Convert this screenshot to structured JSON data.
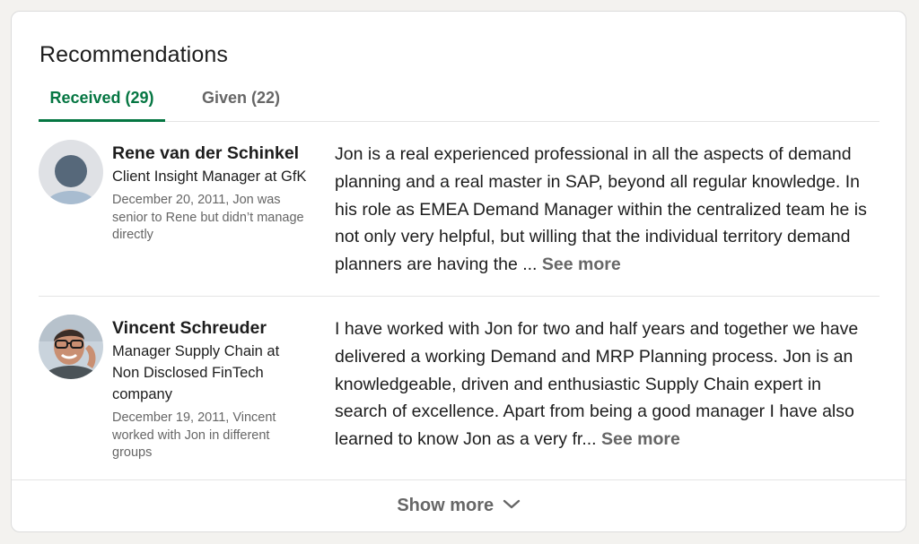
{
  "section": {
    "title": "Recommendations"
  },
  "tabs": [
    {
      "label": "Received (29)",
      "active": true
    },
    {
      "label": "Given (22)",
      "active": false
    }
  ],
  "recommendations": [
    {
      "name": "Rene van der Schinkel",
      "headline": "Client Insight Manager at GfK",
      "meta": "December 20, 2011, Jon was senior to Rene but didn’t manage directly",
      "text": "Jon is a real experienced professional in all the aspects of demand planning and a real master in SAP, beyond all regular knowledge. In his role as EMEA Demand Manager within the centralized team he is not only very helpful, but willing that the individual territory demand planners are having the ...",
      "see_more": "See more",
      "avatar_icon": "default-person-icon"
    },
    {
      "name": "Vincent Schreuder",
      "headline": "Manager Supply Chain at Non Disclosed FinTech company",
      "meta": "December 19, 2011, Vincent worked with Jon in different groups",
      "text": "I have worked with Jon for two and half years and together we have delivered a working Demand and MRP Planning process. Jon is an knowledgeable, driven and enthusiastic Supply Chain expert in search of excellence. Apart from being a good manager I have also learned to know Jon as a very fr...",
      "see_more": "See more",
      "avatar_icon": "person-photo"
    }
  ],
  "footer": {
    "show_more": "Show more"
  },
  "colors": {
    "accent": "#057642",
    "muted": "#666666",
    "divider": "#e4e4e4"
  }
}
